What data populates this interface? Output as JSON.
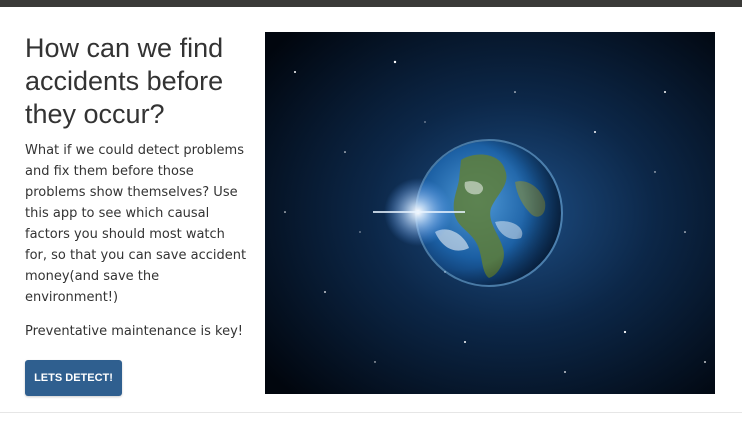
{
  "hero": {
    "heading_lines": [
      "How can we find",
      "accidents before",
      "they occur?"
    ],
    "description_lines": [
      "What if we could detect problems",
      "and fix them before those",
      "problems show themselves? Use",
      "this app to see which causal",
      "factors you should most watch",
      "for, so that you can save accident",
      "money(and save the",
      "environment!)"
    ],
    "key_text": "Preventative maintenance is key!",
    "button_label": "LETS DETECT!"
  },
  "colors": {
    "top_bar": "#3a3a38",
    "button": "#2f5f8f",
    "text": "#333333"
  }
}
